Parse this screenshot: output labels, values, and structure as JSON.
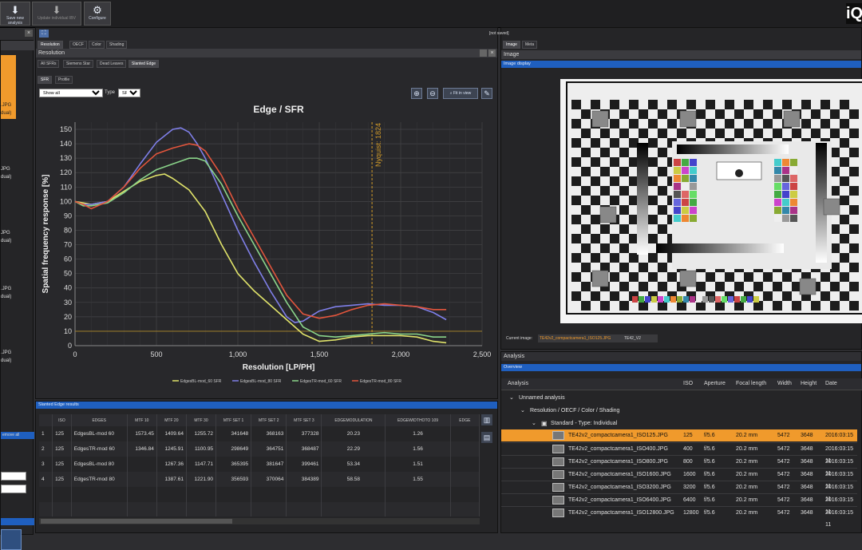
{
  "toolbar": {
    "buttons": [
      {
        "label": "Save new analysis",
        "icon": "download-icon"
      },
      {
        "label": "Update individual IBV",
        "icon": "update-icon"
      },
      {
        "label": "Configure",
        "icon": "gear-icon"
      }
    ],
    "brand": "iQ"
  },
  "resolution_panel": {
    "tabs": [
      "Resolution",
      "OECF",
      "Color",
      "Shading"
    ],
    "title": "Resolution",
    "subtabs": [
      "All SFRs",
      "Siemens Star",
      "Dead Leaves",
      "Slanted Edge"
    ],
    "view_tabs": [
      "SFR",
      "Profile"
    ],
    "show_select": "Show all",
    "type_label": "Type",
    "type_select": "SFR",
    "fit_button": "Fit in view"
  },
  "chart_data": {
    "type": "line",
    "title": "Edge / SFR",
    "xlabel": "Resolution [LP/PH]",
    "ylabel": "Spatial frequency response [%]",
    "xlim": [
      0,
      2500
    ],
    "ylim": [
      0,
      155
    ],
    "xticks": [
      "0",
      "500",
      "1,000",
      "1,500",
      "2,000",
      "2,500"
    ],
    "yticks": [
      "0",
      "10",
      "20",
      "30",
      "40",
      "50",
      "60",
      "70",
      "80",
      "90",
      "100",
      "110",
      "120",
      "130",
      "140",
      "150"
    ],
    "grid": true,
    "legend_position": "bottom",
    "nyquist": {
      "label": "Nyquist: 1824",
      "x": 1824,
      "color": "#d09a2a"
    },
    "threshold_y": 10,
    "series": [
      {
        "name": "EdgesBL-mod_60 SFR",
        "color": "#e0e36a",
        "x": [
          0,
          50,
          100,
          200,
          300,
          400,
          500,
          550,
          600,
          650,
          700,
          800,
          900,
          1000,
          1100,
          1200,
          1300,
          1400,
          1500,
          1600,
          1700,
          1800,
          1900,
          2000,
          2100,
          2200,
          2280
        ],
        "y": [
          100,
          99,
          98,
          100,
          107,
          114,
          118,
          119,
          116,
          112,
          108,
          93,
          70,
          50,
          38,
          28,
          18,
          8,
          3,
          4,
          6,
          7,
          7,
          7,
          6,
          3,
          2
        ]
      },
      {
        "name": "EdgesBL-mod_80 SFR",
        "color": "#7f7fe8",
        "x": [
          0,
          50,
          100,
          200,
          300,
          400,
          500,
          600,
          650,
          700,
          750,
          800,
          900,
          1000,
          1100,
          1200,
          1300,
          1350,
          1400,
          1500,
          1600,
          1700,
          1800,
          1900,
          2000,
          2100,
          2200,
          2280
        ],
        "y": [
          100,
          98,
          98,
          100,
          110,
          126,
          141,
          150,
          151,
          148,
          140,
          130,
          105,
          80,
          58,
          38,
          20,
          16,
          17,
          24,
          27,
          28,
          29,
          28,
          28,
          27,
          23,
          18
        ]
      },
      {
        "name": "EdgesTR-mod_60 SFR",
        "color": "#8ad48a",
        "x": [
          0,
          50,
          100,
          200,
          300,
          400,
          500,
          600,
          700,
          750,
          800,
          900,
          1000,
          1100,
          1200,
          1300,
          1400,
          1500,
          1600,
          1700,
          1800,
          1900,
          2000,
          2100,
          2200,
          2280
        ],
        "y": [
          100,
          97,
          97,
          99,
          106,
          115,
          122,
          126,
          130,
          130,
          128,
          112,
          90,
          70,
          50,
          30,
          13,
          7,
          6,
          7,
          8,
          9,
          8,
          8,
          6,
          6
        ]
      },
      {
        "name": "EdgesTR-mod_80 SFR",
        "color": "#e2553c",
        "x": [
          0,
          50,
          100,
          200,
          300,
          400,
          500,
          600,
          700,
          750,
          800,
          900,
          1000,
          1100,
          1200,
          1300,
          1400,
          1500,
          1600,
          1700,
          1800,
          1900,
          2000,
          2100,
          2200,
          2280
        ],
        "y": [
          100,
          98,
          95,
          100,
          110,
          123,
          133,
          137,
          140,
          139,
          135,
          118,
          95,
          75,
          55,
          35,
          22,
          19,
          21,
          25,
          28,
          29,
          28,
          27,
          25,
          25
        ]
      }
    ]
  },
  "results_panel": {
    "title": "Slanted Edge results",
    "headers": [
      "",
      "ISO",
      "EDGES",
      "MTF 10",
      "MTF 20",
      "MTF 30",
      "MTF SET 1",
      "MTF SET 2",
      "MTF SET 3",
      "EDGEMODULATION",
      "EDGEWIDTHOTO 109",
      "EDGE"
    ],
    "rows": [
      [
        "1",
        "125",
        "EdgesBL-mod 60",
        "1573.45",
        "1409.64",
        "1255.72",
        "341648",
        "368163",
        "377328",
        "20.23",
        "1.26",
        ""
      ],
      [
        "2",
        "125",
        "EdgesTR-mod 60",
        "1346.84",
        "1245.91",
        "1100.95",
        "298649",
        "364751",
        "368487",
        "22.29",
        "1.56",
        ""
      ],
      [
        "3",
        "125",
        "EdgesBL-mod 80",
        "",
        "1267.36",
        "1147.71",
        "365395",
        "381647",
        "399461",
        "53.34",
        "1.51",
        ""
      ],
      [
        "4",
        "125",
        "EdgesTR-mod 80",
        "",
        "1387.61",
        "1221.90",
        "356593",
        "370064",
        "384389",
        "58.58",
        "1.55",
        ""
      ]
    ]
  },
  "image_panel": {
    "status": "[not saved]",
    "tabs": [
      "Image",
      "Meta"
    ],
    "title": "Image",
    "display_label": "Image display",
    "current_label": "Current image:",
    "current_value": "TE42v2_compactcamera1_ISO125.JPG",
    "current_tag": "TE42_V2"
  },
  "analysis_panel": {
    "title": "Analysis",
    "overview_label": "Overview",
    "columns": [
      "Analysis",
      "ISO",
      "Aperture",
      "Focal length",
      "Width",
      "Height",
      "Date"
    ],
    "tree": [
      "Unnamed analysis",
      "Resolution / OECF / Color / Shading",
      "Standard - Type: Individual"
    ],
    "items": [
      {
        "name": "TE42v2_compactcamera1_ISO125.JPG",
        "iso": "125",
        "aperture": "f/5.6",
        "focal": "20.2 mm",
        "width": "5472",
        "height": "3648",
        "date": "2016:03:15 11"
      },
      {
        "name": "TE42v2_compactcamera1_ISO400.JPG",
        "iso": "400",
        "aperture": "f/5.6",
        "focal": "20.2 mm",
        "width": "5472",
        "height": "3648",
        "date": "2016:03:15 11"
      },
      {
        "name": "TE42v2_compactcamera1_ISO800.JPG",
        "iso": "800",
        "aperture": "f/5.6",
        "focal": "20.2 mm",
        "width": "5472",
        "height": "3648",
        "date": "2016:03:15 11"
      },
      {
        "name": "TE42v2_compactcamera1_ISO1600.JPG",
        "iso": "1600",
        "aperture": "f/5.6",
        "focal": "20.2 mm",
        "width": "5472",
        "height": "3648",
        "date": "2016:03:15 11"
      },
      {
        "name": "TE42v2_compactcamera1_ISO3200.JPG",
        "iso": "3200",
        "aperture": "f/5.6",
        "focal": "20.2 mm",
        "width": "5472",
        "height": "3648",
        "date": "2016:03:15 11"
      },
      {
        "name": "TE42v2_compactcamera1_ISO6400.JPG",
        "iso": "6400",
        "aperture": "f/5.6",
        "focal": "20.2 mm",
        "width": "5472",
        "height": "3648",
        "date": "2016:03:15 11"
      },
      {
        "name": "TE42v2_compactcamera1_ISO12800.JPG",
        "iso": "12800",
        "aperture": "f/5.6",
        "focal": "20.2 mm",
        "width": "5472",
        "height": "3648",
        "date": "2016:03:15 11"
      }
    ]
  },
  "sidebar": {
    "fragments": [
      ".JPG",
      "dual)",
      "JPG",
      "dual)",
      "JPG",
      "dual)",
      ".JPG",
      "dual)",
      ".JPG",
      "dual)",
      "emove all"
    ]
  },
  "colors": {
    "accent": "#f09a2c",
    "blue": "#1f5fbf",
    "background": "#2d2d30"
  }
}
